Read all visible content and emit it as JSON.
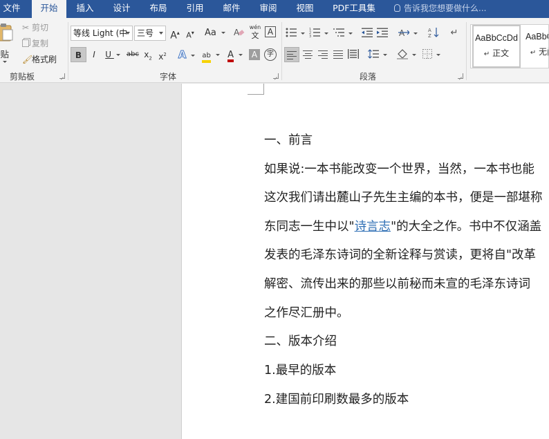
{
  "tabs": [
    {
      "label": "文件"
    },
    {
      "label": "开始"
    },
    {
      "label": "插入"
    },
    {
      "label": "设计"
    },
    {
      "label": "布局"
    },
    {
      "label": "引用"
    },
    {
      "label": "邮件"
    },
    {
      "label": "审阅"
    },
    {
      "label": "视图"
    },
    {
      "label": "PDF工具集"
    }
  ],
  "tell_me": "告诉我您想要做什么...",
  "clipboard": {
    "paste": "粘贴",
    "cut": "剪切",
    "copy": "复制",
    "format_painter": "格式刷",
    "group_label": "剪贴板"
  },
  "font": {
    "font_name": "等线 Light (中",
    "font_size": "三号",
    "grow": "A",
    "shrink": "A",
    "case": "Aa",
    "phonetic_top": "wén",
    "phonetic_bottom": "文",
    "border_char": "A",
    "bold": "B",
    "italic": "I",
    "underline": "U",
    "strike": "abc",
    "subscript": "x",
    "superscript": "x",
    "effects": "A",
    "highlight": "ab",
    "font_color": "A",
    "char_shading": "A",
    "enclose": "字",
    "group_label": "字体"
  },
  "paragraph": {
    "group_label": "段落"
  },
  "styles": {
    "items": [
      {
        "preview": "AaBbCcDd",
        "name": "正文"
      },
      {
        "preview": "AaBbCcDd",
        "name": "无间隔"
      }
    ]
  },
  "document": {
    "heading1": "一、前言",
    "p1": "如果说:一本书能改变一个世界，当然，一本书也能",
    "p2": "这次我们请出麓山子先生主编的本书，便是一部堪称",
    "p3_before": "东同志一生中以\"",
    "p3_link": "诗言志",
    "p3_after": "\"的大全之作。书中不仅涵盖",
    "p4": "发表的毛泽东诗词的全新诠释与赏读，更将自\"改革",
    "p5": "解密、流传出来的那些以前秘而未宣的毛泽东诗词",
    "p6": "之作尽汇册中。",
    "heading2": "二、版本介绍",
    "item1": "1.最早的版本",
    "item2": "2.建国前印刷数最多的版本"
  },
  "colors": {
    "tab_bar": "#2b579a",
    "ribbon": "#f3f3f3",
    "link": "#2f6fb5",
    "highlight": "#f6d200",
    "font_color_bar": "#c00000"
  }
}
